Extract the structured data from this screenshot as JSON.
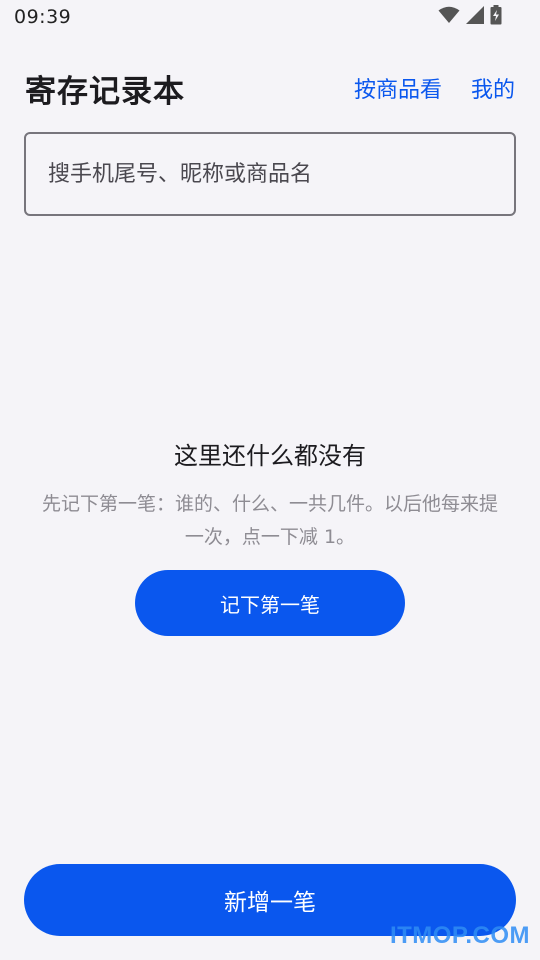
{
  "status_bar": {
    "time": "09:39",
    "icons": [
      "wifi-icon",
      "cellular-signal-icon",
      "battery-charging-icon"
    ]
  },
  "header": {
    "title": "寄存记录本",
    "by_product_link": "按商品看",
    "mine_link": "我的"
  },
  "search": {
    "placeholder": "搜手机尾号、昵称或商品名",
    "value": ""
  },
  "empty_state": {
    "title": "这里还什么都没有",
    "description": "先记下第一笔：谁的、什么、一共几件。以后他每来提一次，点一下减 1。",
    "button_label": "记下第一笔"
  },
  "footer": {
    "add_button_label": "新增一笔"
  },
  "watermark": "ITMOP.COM",
  "colors": {
    "accent": "#0a57ee",
    "background": "#f5f4f8",
    "muted_text": "#8e8c93"
  }
}
